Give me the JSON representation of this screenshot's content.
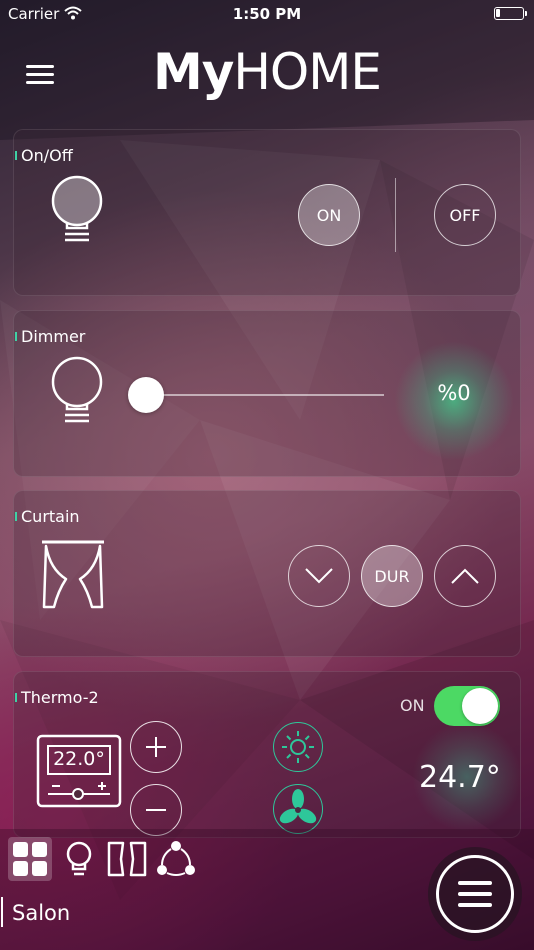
{
  "status_bar": {
    "carrier": "Carrier",
    "time": "1:50 PM"
  },
  "header": {
    "logo_bold": "My",
    "logo_light": "HOME"
  },
  "cards": {
    "onoff": {
      "title": "On/Off",
      "on_label": "ON",
      "off_label": "OFF"
    },
    "dimmer": {
      "title": "Dimmer",
      "value": "%0",
      "level": 0
    },
    "curtain": {
      "title": "Curtain",
      "stop_label": "DUR"
    },
    "thermo": {
      "title": "Thermo-2",
      "toggle_label": "ON",
      "toggle_on": true,
      "setpoint": "22.0°",
      "current_temp": "24.7°"
    }
  },
  "bottom_tabs": [
    "grid-icon",
    "bulb-icon",
    "curtain-icon",
    "scenario-icon"
  ],
  "room": {
    "name": "Salon"
  },
  "colors": {
    "accent": "#3fd1a5",
    "toggle_on": "#4cd964"
  }
}
